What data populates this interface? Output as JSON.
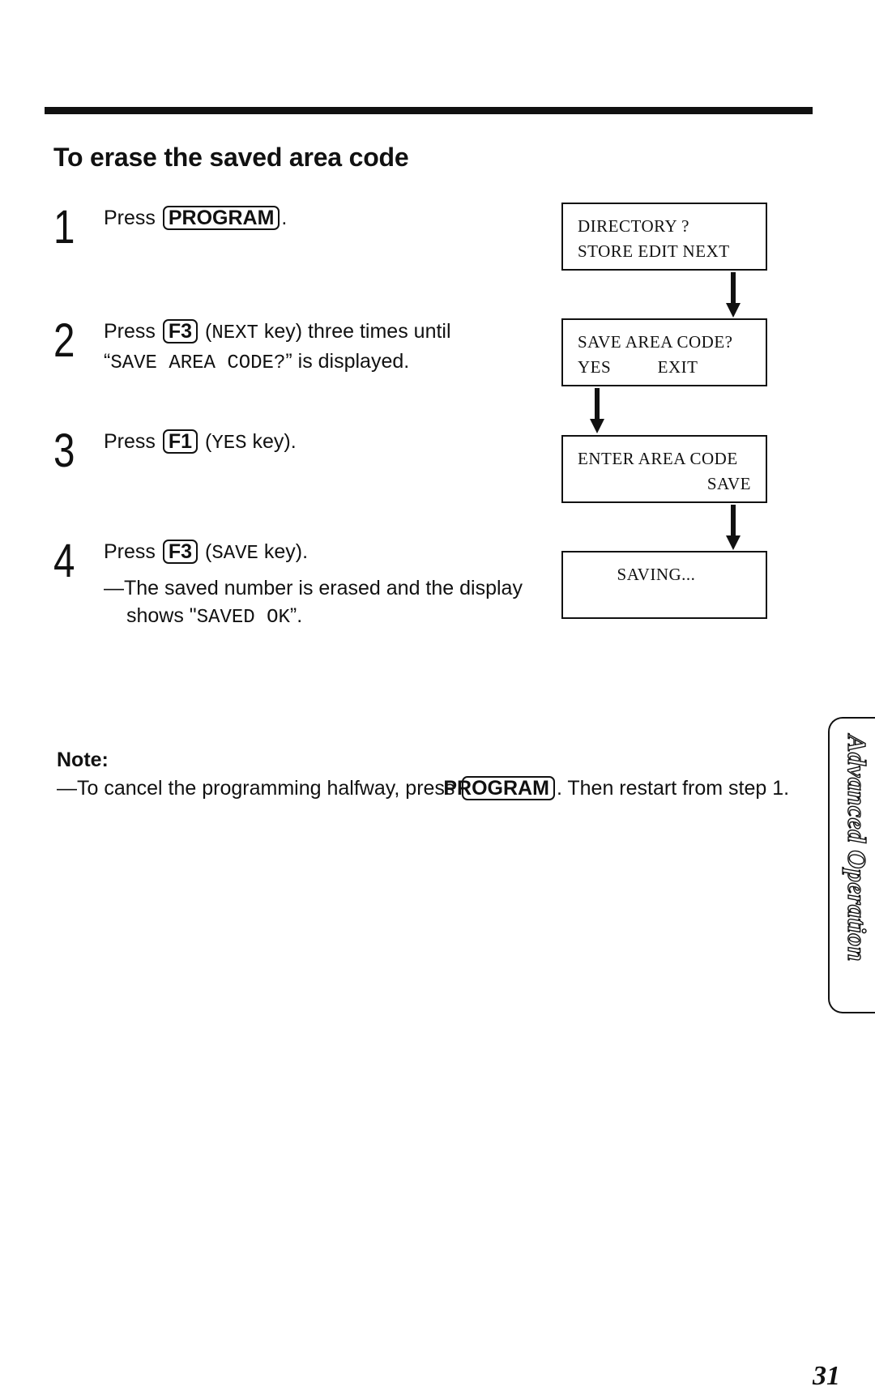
{
  "heading": "To erase the saved area code",
  "steps": [
    {
      "number": "1",
      "parts": {
        "pre": "Press ",
        "key": "PROGRAM",
        "post": "."
      }
    },
    {
      "number": "2",
      "parts": {
        "pre": "Press ",
        "key": "F3",
        "mid1": " (",
        "mono1": "NEXT",
        "mid2": " key) three times until",
        "quote_open": "“",
        "mono2": "SAVE AREA CODE?",
        "tail": "” is displayed."
      }
    },
    {
      "number": "3",
      "parts": {
        "pre": "Press ",
        "key": "F1",
        "mid1": " (",
        "mono1": "YES",
        "tail": " key)."
      }
    },
    {
      "number": "4",
      "parts": {
        "pre": "Press ",
        "key": "F3",
        "mid1": " (",
        "mono1": "SAVE",
        "tail": " key).",
        "sub_pre": "—The saved number is erased and the display shows \"",
        "sub_mono": "SAVED OK",
        "sub_post": "”."
      }
    }
  ],
  "displays": [
    {
      "line1": "DIRECTORY ?",
      "line2": "STORE EDIT NEXT"
    },
    {
      "line1": "SAVE AREA CODE?",
      "line2": "YES          EXIT"
    },
    {
      "line1": "ENTER AREA CODE",
      "line2": "SAVE"
    },
    {
      "line1": "SAVING...",
      "line2": ""
    }
  ],
  "note": {
    "title": "Note:",
    "pre": "—To cancel the programming halfway, press ",
    "key": "PROGRAM",
    "post": ". Then restart from step 1."
  },
  "side_tab": {
    "label": "Advanced Operation"
  },
  "page_number": "31"
}
